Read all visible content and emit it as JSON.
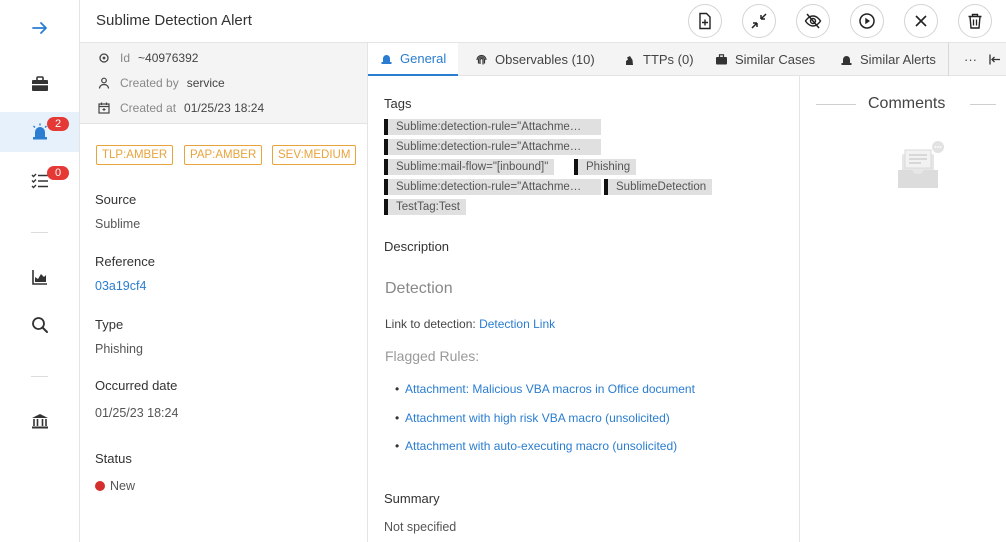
{
  "nav": {
    "badges": {
      "alerts": "2",
      "tasks": "0"
    }
  },
  "header": {
    "title": "Sublime Detection Alert"
  },
  "meta": {
    "id_label": "Id",
    "id_value": "~40976392",
    "created_by_label": "Created by",
    "created_by_value": "service",
    "created_at_label": "Created at",
    "created_at_value": "01/25/23 18:24"
  },
  "pills": [
    "TLP:AMBER",
    "PAP:AMBER",
    "SEV:MEDIUM"
  ],
  "fields": {
    "source_label": "Source",
    "source_value": "Sublime",
    "reference_label": "Reference",
    "reference_value": "03a19cf4",
    "type_label": "Type",
    "type_value": "Phishing",
    "occurred_label": "Occurred date",
    "occurred_value": "01/25/23 18:24",
    "status_label": "Status",
    "status_value": "New"
  },
  "tabs": {
    "general": "General",
    "observables": "Observables (10)",
    "ttps": "TTPs (0)",
    "similar_cases": "Similar Cases",
    "similar_alerts": "Similar Alerts",
    "more": "···"
  },
  "general": {
    "tags_title": "Tags",
    "tags": [
      "Sublime:detection-rule=\"Attachme…",
      "Sublime:detection-rule=\"Attachme…",
      "Sublime:mail-flow=\"[inbound]\"",
      "Phishing",
      "Sublime:detection-rule=\"Attachme…",
      "SublimeDetection",
      "TestTag:Test"
    ],
    "description_title": "Description",
    "detection_heading": "Detection",
    "link_prefix": "Link to detection:",
    "link_text": "Detection Link",
    "flagged_heading": "Flagged Rules:",
    "rules": [
      "Attachment: Malicious VBA macros in Office document",
      "Attachment with high risk VBA macro (unsolicited)",
      "Attachment with auto-executing macro (unsolicited)"
    ],
    "summary_title": "Summary",
    "summary_value": "Not specified"
  },
  "comments": {
    "title": "Comments"
  },
  "colors": {
    "accent": "#2a7dd0",
    "amber": "#e8a33b",
    "badge": "#e53935",
    "status_new": "#d32f2f"
  }
}
